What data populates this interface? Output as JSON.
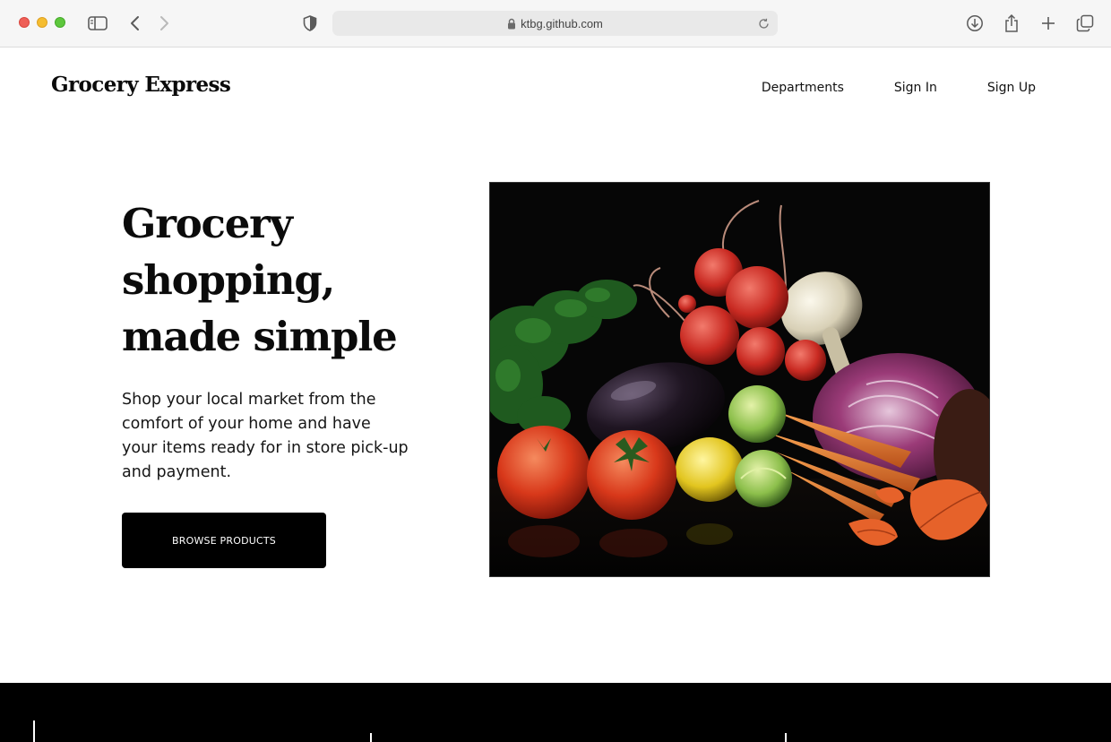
{
  "browser": {
    "url": "ktbg.github.com",
    "icons": [
      "sidebar-icon",
      "back-icon",
      "forward-icon",
      "shield-icon",
      "lock-icon",
      "reload-icon",
      "download-icon",
      "share-icon",
      "plus-icon",
      "tabs-icon"
    ]
  },
  "site": {
    "brand": "Grocery Express",
    "nav": [
      {
        "label": "Departments"
      },
      {
        "label": "Sign In"
      },
      {
        "label": "Sign Up"
      }
    ]
  },
  "hero": {
    "title_line1": "Grocery",
    "title_line2": "shopping,",
    "title_line3": "made simple",
    "subtitle": "Shop your local market from the comfort of your home and have your items ready for in store pick-up and payment.",
    "cta_label": "BROWSE PRODUCTS"
  },
  "colors": {
    "accent": "#000000",
    "background": "#ffffff",
    "text": "#111111"
  }
}
